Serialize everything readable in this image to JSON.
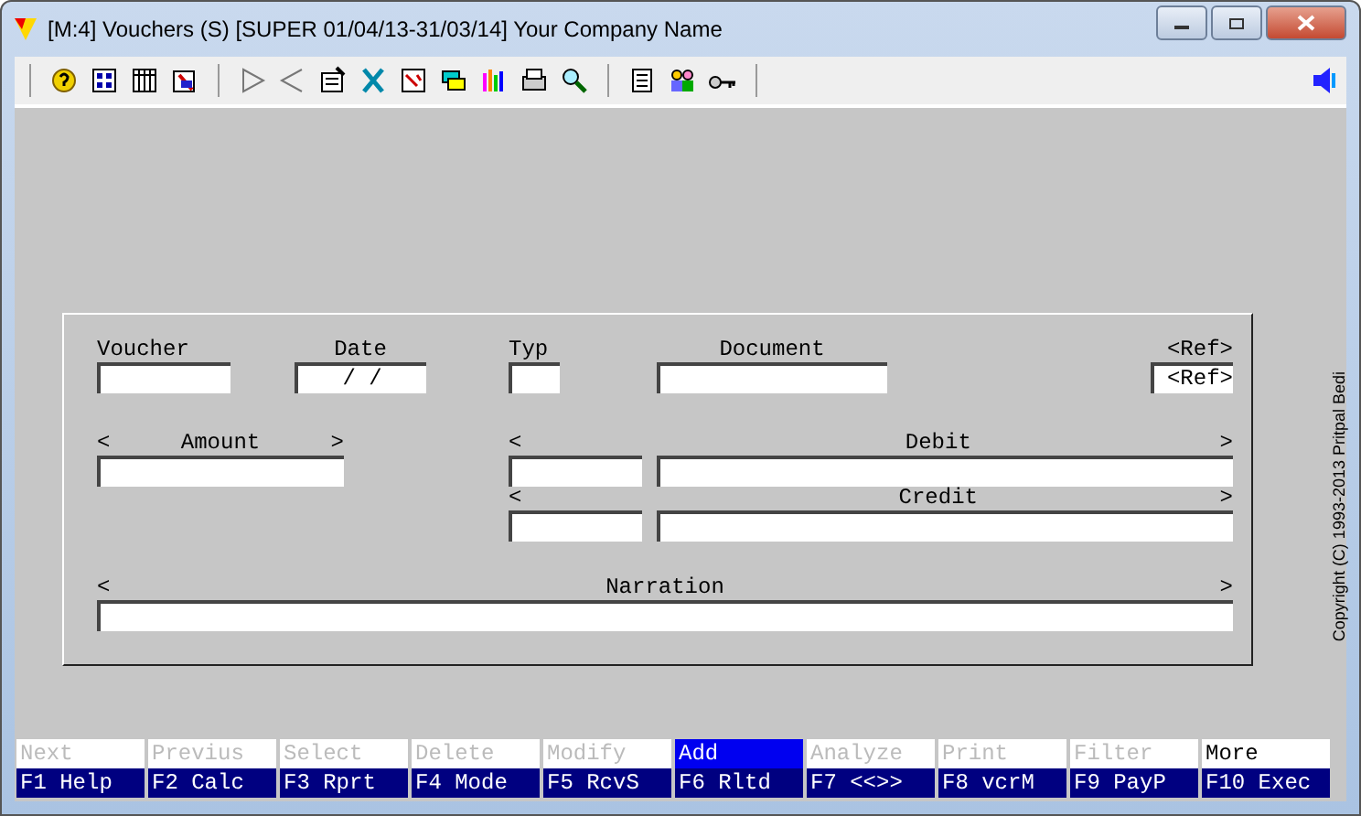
{
  "window": {
    "title": "[M:4]  Vouchers (S)  [SUPER  01/04/13-31/03/14]  Your Company Name"
  },
  "form": {
    "top_fields": [
      {
        "label": "Voucher"
      },
      {
        "label": "Date",
        "value": "/  /"
      },
      {
        "label": "Typ"
      },
      {
        "label": "Document"
      },
      {
        "label": "<Ref>",
        "value": "<Ref>"
      }
    ],
    "amount": {
      "left": "<",
      "label": "Amount",
      "right": ">"
    },
    "debit": {
      "left": "<",
      "label": "Debit",
      "right": ">"
    },
    "credit": {
      "left": "<",
      "label": "Credit",
      "right": ">"
    },
    "narration": {
      "left": "<",
      "label": "Narration",
      "right": ">"
    }
  },
  "copyright": "Copyright (C) 1993-2013 Pritpal Bedi",
  "actions": [
    {
      "label": "Next",
      "disabled": true,
      "selected": false
    },
    {
      "label": "Previus",
      "disabled": true,
      "selected": false
    },
    {
      "label": "Select",
      "disabled": true,
      "selected": false
    },
    {
      "label": "Delete",
      "disabled": true,
      "selected": false
    },
    {
      "label": "Modify",
      "disabled": true,
      "selected": false
    },
    {
      "label": "Add",
      "disabled": false,
      "selected": true
    },
    {
      "label": "Analyze",
      "disabled": true,
      "selected": false
    },
    {
      "label": "Print",
      "disabled": true,
      "selected": false
    },
    {
      "label": "Filter",
      "disabled": true,
      "selected": false
    },
    {
      "label": "More",
      "disabled": false,
      "selected": false
    }
  ],
  "function_keys": [
    "F1 Help",
    "F2 Calc",
    "F3 Rprt",
    "F4 Mode",
    "F5 RcvS",
    "F6 Rltd",
    "F7 <<>>",
    "F8 vcrM",
    "F9 PayP",
    "F10 Exec"
  ]
}
